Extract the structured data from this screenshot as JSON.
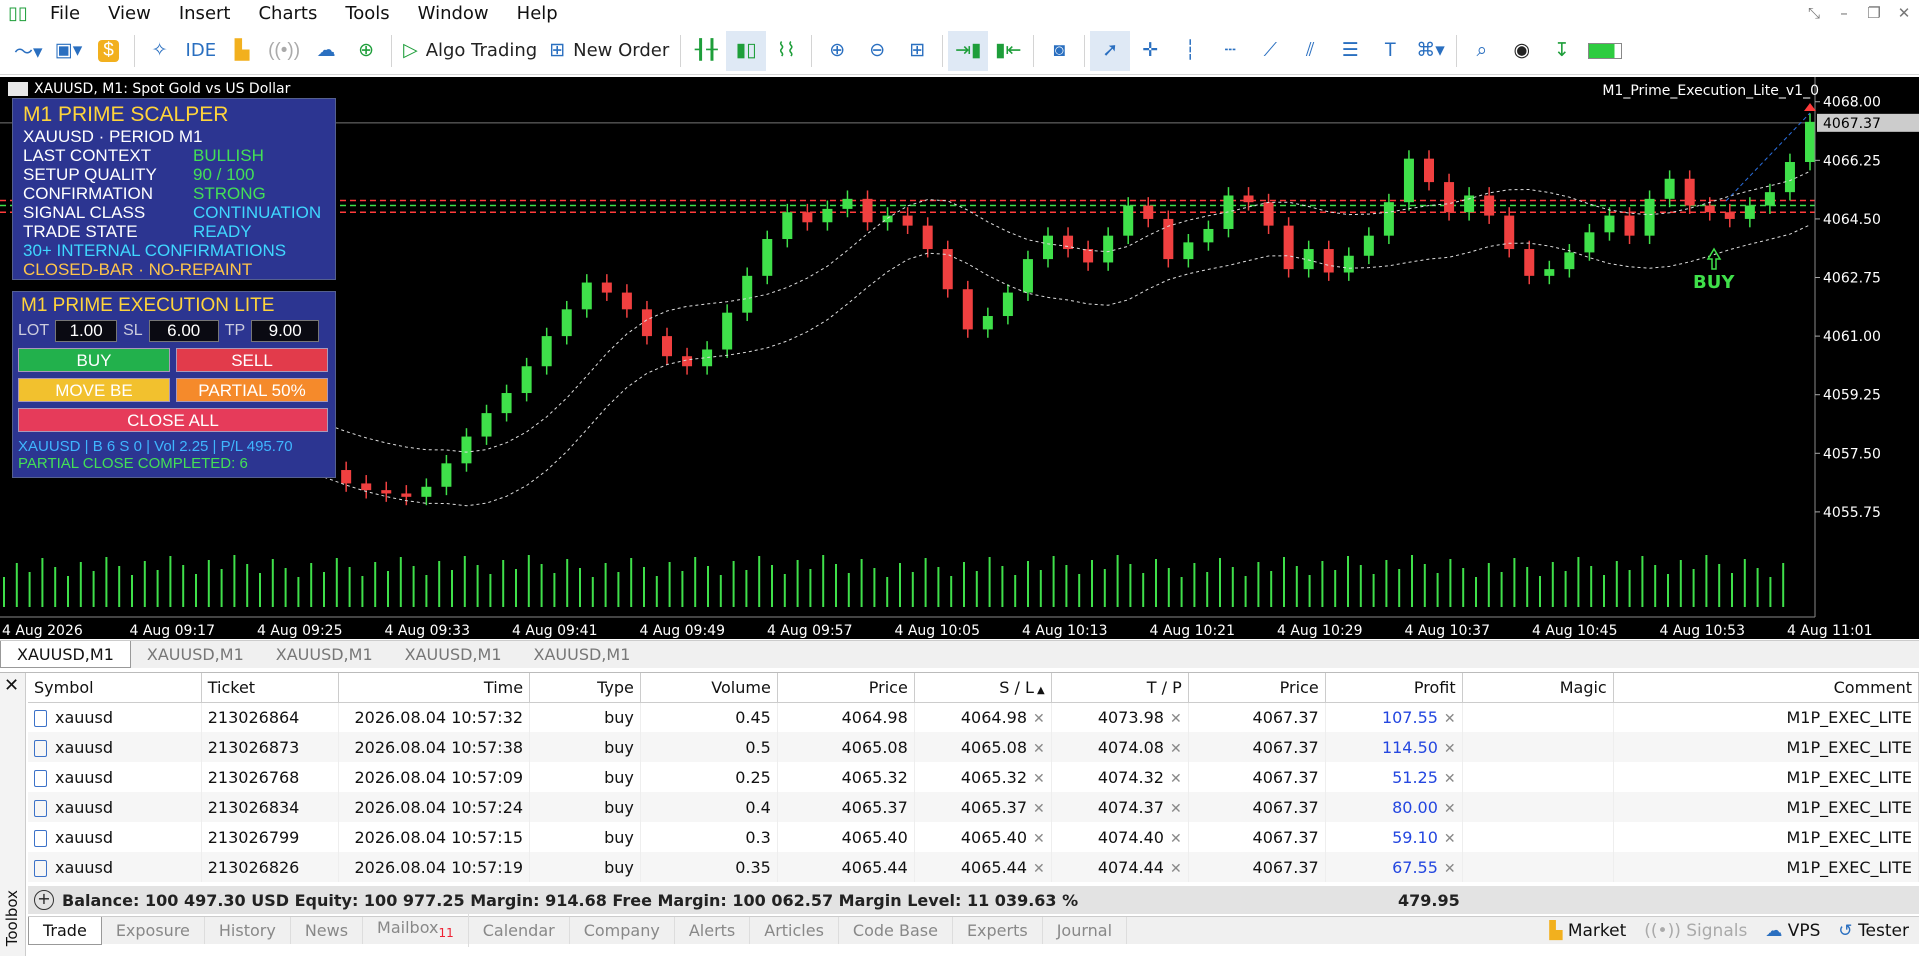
{
  "menu": {
    "items": [
      "File",
      "View",
      "Insert",
      "Charts",
      "Tools",
      "Window",
      "Help"
    ]
  },
  "toolbar": {
    "ide_label": "IDE",
    "algo_label": "Algo Trading",
    "new_order_label": "New Order"
  },
  "chart": {
    "header": "XAUUSD, M1:  Spot Gold vs US Dollar",
    "ea_name": "M1_Prime_Execution_Lite_v1_0",
    "current_price": "4067.37",
    "signal_label": "BUY",
    "price_ticks": [
      "4068.00",
      "4066.25",
      "4064.50",
      "4062.75",
      "4061.00",
      "4059.25",
      "4057.50",
      "4055.75"
    ],
    "time_ticks": [
      "4 Aug 2026",
      "4 Aug 09:17",
      "4 Aug 09:25",
      "4 Aug 09:33",
      "4 Aug 09:41",
      "4 Aug 09:49",
      "4 Aug 09:57",
      "4 Aug 10:05",
      "4 Aug 10:13",
      "4 Aug 10:21",
      "4 Aug 10:29",
      "4 Aug 10:37",
      "4 Aug 10:45",
      "4 Aug 10:53",
      "4 Aug 11:01"
    ],
    "colors": {
      "bull": "#3fe04a",
      "bear": "#f04040",
      "bg": "#000000"
    }
  },
  "chart_data": {
    "type": "candlestick",
    "symbol": "XAUUSD",
    "timeframe": "M1",
    "ylim": [
      4055.0,
      4068.5
    ],
    "closes": [
      4058.0,
      4057.3,
      4057.0,
      4056.6,
      4056.4,
      4056.3,
      4056.2,
      4056.5,
      4057.2,
      4058.0,
      4058.7,
      4059.3,
      4060.1,
      4061.0,
      4061.8,
      4062.6,
      4062.3,
      4061.8,
      4061.0,
      4060.4,
      4060.1,
      4060.6,
      4061.7,
      4062.8,
      4063.9,
      4064.7,
      4064.4,
      4064.8,
      4065.1,
      4064.4,
      4064.6,
      4064.3,
      4063.6,
      4062.4,
      4061.2,
      4061.6,
      4062.3,
      4063.3,
      4064.0,
      4063.6,
      4063.2,
      4064.0,
      4064.9,
      4064.5,
      4063.3,
      4063.8,
      4064.2,
      4065.2,
      4065.0,
      4064.3,
      4063.0,
      4063.6,
      4062.9,
      4063.4,
      4064.0,
      4065.0,
      4066.3,
      4065.6,
      4064.7,
      4065.2,
      4064.6,
      4063.6,
      4062.8,
      4063.0,
      4063.5,
      4064.1,
      4064.6,
      4064.0,
      4065.1,
      4065.7,
      4064.9,
      4064.7,
      4064.5,
      4064.9,
      4065.3,
      4066.2,
      4067.4
    ]
  },
  "panel1": {
    "title": "M1 PRIME SCALPER",
    "line1": "XAUUSD · PERIOD M1",
    "rows": [
      {
        "k": "LAST CONTEXT",
        "v": "BULLISH"
      },
      {
        "k": "SETUP QUALITY",
        "v": "90 / 100"
      },
      {
        "k": "CONFIRMATION",
        "v": "STRONG"
      },
      {
        "k": "SIGNAL CLASS",
        "v": "CONTINUATION"
      },
      {
        "k": "TRADE STATE",
        "v": "READY"
      }
    ],
    "line_conf": "30+ INTERNAL CONFIRMATIONS",
    "line_bar": "CLOSED-BAR · NO-REPAINT"
  },
  "panel2": {
    "title": "M1 PRIME EXECUTION LITE",
    "lot_label": "LOT",
    "lot": "1.00",
    "sl_label": "SL",
    "sl": "6.00",
    "tp_label": "TP",
    "tp": "9.00",
    "buy": "BUY",
    "sell": "SELL",
    "move_be": "MOVE BE",
    "partial": "PARTIAL 50%",
    "close_all": "CLOSE ALL",
    "info": "XAUUSD | B 6 S 0 | Vol 2.25 | P/L 495.70",
    "partial_done": "PARTIAL CLOSE COMPLETED: 6"
  },
  "chart_tabs": [
    "XAUUSD,M1",
    "XAUUSD,M1",
    "XAUUSD,M1",
    "XAUUSD,M1",
    "XAUUSD,M1"
  ],
  "trade": {
    "columns": [
      "Symbol",
      "Ticket",
      "Time",
      "Type",
      "Volume",
      "Price",
      "S / L",
      "T / P",
      "Price",
      "Profit",
      "Magic",
      "Comment"
    ],
    "rows": [
      [
        "xauusd",
        "213026864",
        "2026.08.04 10:57:32",
        "buy",
        "0.45",
        "4064.98",
        "4064.98",
        "4073.98",
        "4067.37",
        "107.55",
        "",
        "M1P_EXEC_LITE"
      ],
      [
        "xauusd",
        "213026873",
        "2026.08.04 10:57:38",
        "buy",
        "0.5",
        "4065.08",
        "4065.08",
        "4074.08",
        "4067.37",
        "114.50",
        "",
        "M1P_EXEC_LITE"
      ],
      [
        "xauusd",
        "213026768",
        "2026.08.04 10:57:09",
        "buy",
        "0.25",
        "4065.32",
        "4065.32",
        "4074.32",
        "4067.37",
        "51.25",
        "",
        "M1P_EXEC_LITE"
      ],
      [
        "xauusd",
        "213026834",
        "2026.08.04 10:57:24",
        "buy",
        "0.4",
        "4065.37",
        "4065.37",
        "4074.37",
        "4067.37",
        "80.00",
        "",
        "M1P_EXEC_LITE"
      ],
      [
        "xauusd",
        "213026799",
        "2026.08.04 10:57:15",
        "buy",
        "0.3",
        "4065.40",
        "4065.40",
        "4074.40",
        "4067.37",
        "59.10",
        "",
        "M1P_EXEC_LITE"
      ],
      [
        "xauusd",
        "213026826",
        "2026.08.04 10:57:19",
        "buy",
        "0.35",
        "4065.44",
        "4065.44",
        "4074.44",
        "4067.37",
        "67.55",
        "",
        "M1P_EXEC_LITE"
      ]
    ],
    "summary": "Balance: 100 497.30 USD  Equity: 100 977.25  Margin: 914.68  Free Margin: 100 062.57  Margin Level: 11 039.63 %",
    "total": "479.95"
  },
  "toolbox_label": "Toolbox",
  "bottom_tabs": [
    "Trade",
    "Exposure",
    "History",
    "News",
    "Mailbox",
    "Calendar",
    "Company",
    "Alerts",
    "Articles",
    "Code Base",
    "Experts",
    "Journal"
  ],
  "mailbox_badge": "11",
  "right_tabs": [
    "Market",
    "Signals",
    "VPS",
    "Tester"
  ]
}
